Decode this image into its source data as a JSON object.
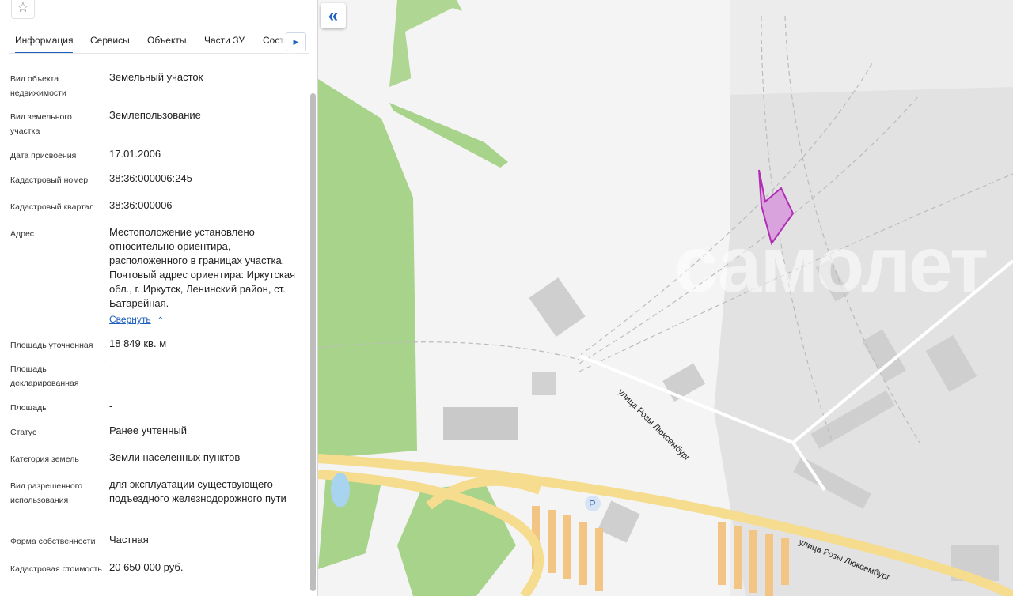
{
  "panel": {
    "star_icon": "star-outline-icon",
    "tabs": [
      {
        "label": "Информация",
        "active": true
      },
      {
        "label": "Сервисы",
        "active": false
      },
      {
        "label": "Объекты",
        "active": false
      },
      {
        "label": "Части ЗУ",
        "active": false
      },
      {
        "label": "Соста",
        "active": false
      }
    ],
    "tabs_next_icon": "chevron-right-icon",
    "fields": [
      {
        "label": "Вид объекта недвижимости",
        "value": "Земельный участок"
      },
      {
        "label": "Вид земельного участка",
        "value": "Землепользование"
      },
      {
        "label": "Дата присвоения",
        "value": "17.01.2006"
      },
      {
        "label": "Кадастровый номер",
        "value": "38:36:000006:245"
      },
      {
        "label": "Кадастровый квартал",
        "value": "38:36:000006"
      },
      {
        "label": "Адрес",
        "value": "Местоположение установлено относительно ориентира, расположенного в границах участка. Почтовый адрес ориентира: Иркутская обл., г. Иркутск, Ленинский район, ст. Батарейная."
      },
      {
        "label": "Площадь уточненная",
        "value": "18 849 кв. м"
      },
      {
        "label": "Площадь декларированная",
        "value": "-"
      },
      {
        "label": "Площадь",
        "value": "-"
      },
      {
        "label": "Статус",
        "value": "Ранее учтенный"
      },
      {
        "label": "Категория земель",
        "value": "Земли населенных пунктов"
      },
      {
        "label": "Вид разрешенного использования",
        "value": "для эксплуатации существующего подъездного железнодорожного пути"
      },
      {
        "label": "Форма собственности",
        "value": "Частная"
      },
      {
        "label": "Кадастровая стоимость",
        "value": "20 650 000 руб."
      }
    ],
    "collapse_link": "Свернуть",
    "collapse_icon": "chevron-up-icon"
  },
  "map": {
    "collapse_panel_icon": "double-chevron-left-icon",
    "watermark": "самолет",
    "streets": [
      "улица Розы Люксембург",
      "улица Розы Люксембург"
    ],
    "parking_label": "P",
    "colors": {
      "parcel": "#b12fb5",
      "parcel_fill": "#d9a3dd",
      "forest": "#a8d38a",
      "road": "#f6dc8f",
      "residential": "#f3c584"
    }
  }
}
